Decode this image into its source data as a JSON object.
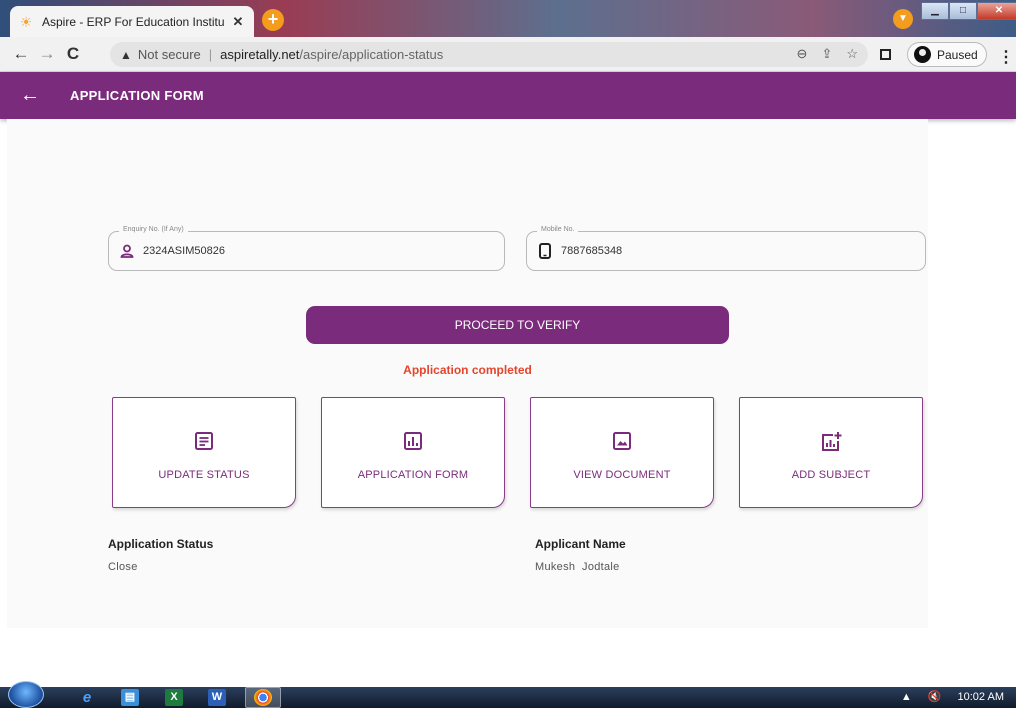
{
  "browser": {
    "tab_title": "Aspire - ERP For Education Institu",
    "security_label": "Not secure",
    "url_domain": "aspiretally.net",
    "url_path": "/aspire/application-status",
    "profile_label": "Paused"
  },
  "appbar": {
    "title": "APPLICATION FORM"
  },
  "form": {
    "enquiry_legend": "Enquiry No. (If Any)",
    "enquiry_value": "2324ASIM50826",
    "mobile_legend": "Mobile No.",
    "mobile_value": "7887685348",
    "proceed_label": "PROCEED TO VERIFY",
    "status_message": "Application completed"
  },
  "cards": [
    {
      "label": "UPDATE STATUS",
      "icon": "document-lines-icon"
    },
    {
      "label": "APPLICATION FORM",
      "icon": "bar-chart-icon"
    },
    {
      "label": "VIEW DOCUMENT",
      "icon": "image-icon"
    },
    {
      "label": "ADD SUBJECT",
      "icon": "chart-add-icon"
    }
  ],
  "info": {
    "application_status_label": "Application Status",
    "application_status_value": "Close",
    "applicant_name_label": "Applicant Name",
    "applicant_name_value": "Mukesh  Jodtale"
  },
  "taskbar": {
    "clock": "10:02 AM"
  },
  "colors": {
    "brand": "#7b2b7b",
    "status_message": "#e4452c",
    "content_bg": "#fafafa"
  }
}
